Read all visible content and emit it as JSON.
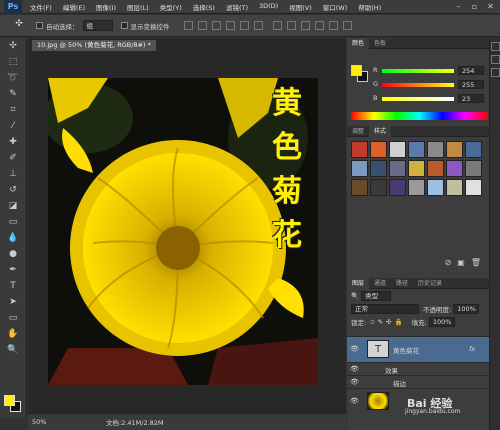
{
  "app": {
    "logo": "Ps"
  },
  "menu": [
    "文件(F)",
    "编辑(E)",
    "图像(I)",
    "图层(L)",
    "类型(Y)",
    "选择(S)",
    "滤镜(T)",
    "3D(D)",
    "视图(V)",
    "窗口(W)",
    "帮助(H)"
  ],
  "options_bar": {
    "auto_select_label": "自动选择：",
    "auto_select_value": "组",
    "show_transform_label": "显示变换控件"
  },
  "document": {
    "tab_title": "10.jpg @ 50% (黄色菊花, RGB/8#) *",
    "zoom": "50%",
    "doc_info": "文档:2.41M/2.82M"
  },
  "canvas_text": {
    "title": "黄色菊花"
  },
  "color_panel": {
    "tabs": [
      "颜色",
      "色板"
    ],
    "sliders": [
      {
        "label": "R",
        "value": "254"
      },
      {
        "label": "G",
        "value": "255"
      },
      {
        "label": "B",
        "value": "23"
      }
    ],
    "fg_color": "#ffef00",
    "bg_color": "#111111"
  },
  "styles_panel": {
    "tabs": [
      "调整",
      "样式"
    ],
    "swatches": [
      "#c23a2a",
      "#e0602a",
      "#d0d0d0",
      "#5a7aa8",
      "#8a8a8a",
      "#c08a40",
      "#4a6a9a",
      "#7a9ac0",
      "#3a5070",
      "#6a6a8a",
      "#d0b040",
      "#b85a2a",
      "#8a5ac0",
      "#7a7a7a",
      "#6b4a2a",
      "#3a3a3a",
      "#4a3a70",
      "#9a9a9a",
      "#a0c0e0",
      "#c0c0a0",
      "#e0e0e0"
    ]
  },
  "layers_panel": {
    "tabs": [
      "图层",
      "通道",
      "路径",
      "历史记录"
    ],
    "filter": "类型",
    "blend_mode": "正常",
    "opacity_label": "不透明度:",
    "opacity_value": "100%",
    "lock_label": "锁定:",
    "fill_label": "填充:",
    "fill_value": "100%",
    "layers": [
      {
        "name": "黄色菊花",
        "fx": "fx"
      },
      {
        "name": "效果"
      },
      {
        "name": "描边"
      }
    ]
  },
  "watermark": {
    "text": "Bai 经验",
    "url": "jingyan.baidu.com"
  }
}
